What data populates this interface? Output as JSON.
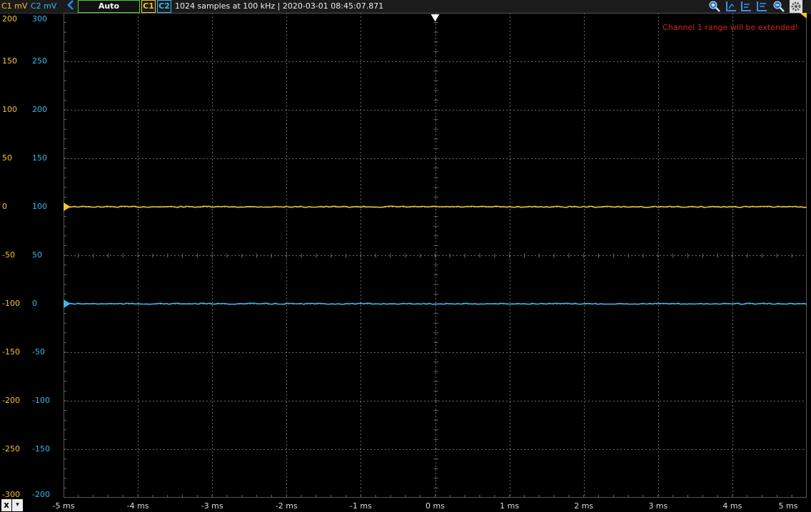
{
  "header": {
    "c1_unit_label": "C1 mV",
    "c2_unit_label": "C2 mV",
    "mode_button": "Auto",
    "c1_button": "C1",
    "c2_button": "C2",
    "info": "1024 samples at 100 kHz | 2020-03-01 08:45:07.871"
  },
  "warning": "Channel 1 range will be extended!",
  "toolbar": {
    "icons": [
      "zoom-in-icon",
      "cursor-left-icon",
      "cursor-both-icon",
      "cursor-right-icon",
      "zoom-out-icon",
      "settings-icon"
    ]
  },
  "bottom": {
    "x_button": "x",
    "x_dropdown": "▾"
  },
  "colors": {
    "c1": "#f2c230",
    "c2": "#3bb8ee",
    "grid": "#6a6a6a",
    "trigger": "#ffffff"
  },
  "chart_data": {
    "type": "line",
    "x_ticks": [
      "-5 ms",
      "-4 ms",
      "-3 ms",
      "-2 ms",
      "-1 ms",
      "0 ms",
      "1 ms",
      "2 ms",
      "3 ms",
      "4 ms",
      "5 ms"
    ],
    "xlim": [
      -5,
      5
    ],
    "c1_ticks": [
      "200",
      "150",
      "100",
      "50",
      "0",
      "-50",
      "-100",
      "-150",
      "-200",
      "-250",
      "-300"
    ],
    "c2_ticks": [
      "300",
      "250",
      "200",
      "150",
      "100",
      "50",
      "0",
      "-50",
      "-100",
      "-150",
      "-200"
    ],
    "c1_ylim": [
      -300,
      200
    ],
    "c2_ylim": [
      -200,
      300
    ],
    "series": [
      {
        "name": "C1",
        "x": [
          -5,
          5
        ],
        "values": [
          0,
          0
        ]
      },
      {
        "name": "C2",
        "x": [
          -5,
          5
        ],
        "values": [
          0,
          0
        ]
      }
    ],
    "trigger_time": 0,
    "grid": true
  }
}
